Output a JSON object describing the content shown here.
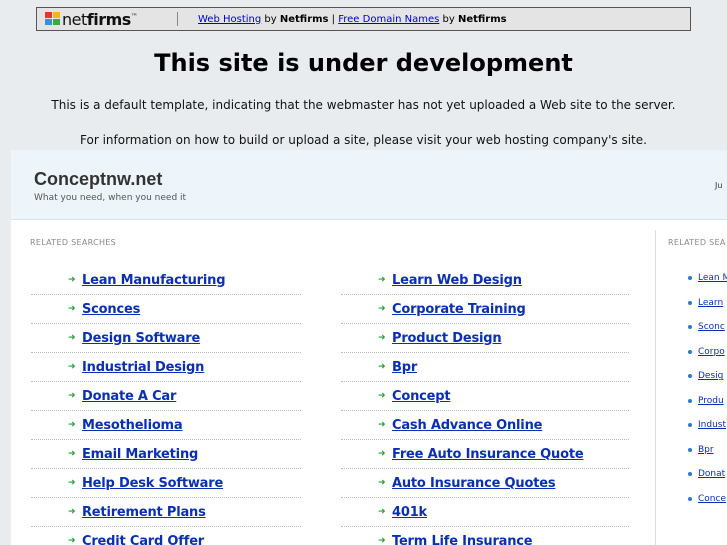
{
  "netfirms_bar": {
    "logo_text_1": "net",
    "logo_text_2": "firms",
    "logo_tm": "™",
    "link1": "Web Hosting",
    "by1": " by ",
    "brand1": "Netfirms",
    "pipe": " | ",
    "link2": "Free Domain Names",
    "by2": " by ",
    "brand2": "Netfirms"
  },
  "header": {
    "title": "This site is under development",
    "line1": "This is a default template, indicating that the webmaster has not yet uploaded a Web site to the server.",
    "line2": "For information on how to build or upload a site, please visit your web hosting company's site."
  },
  "parked": {
    "domain": "Conceptnw.net",
    "tagline": "What you need, when you need it",
    "right_text": "Ju",
    "related_label": "RELATED SEARCHES",
    "side_label": "RELATED SEA",
    "col1": [
      "Lean Manufacturing",
      "Sconces",
      "Design Software",
      "Industrial Design",
      "Donate A Car",
      "Mesothelioma",
      "Email Marketing",
      "Help Desk Software",
      "Retirement Plans",
      "Credit Card Offer"
    ],
    "col2": [
      "Learn Web Design",
      "Corporate Training",
      "Product Design",
      "Bpr",
      "Concept",
      "Cash Advance Online",
      "Free Auto Insurance Quote",
      "Auto Insurance Quotes",
      "401k",
      "Term Life Insurance"
    ],
    "side": [
      "Lean M",
      "Learn",
      "Sconc",
      "Corpo",
      "Desig",
      "Produ",
      "Indust",
      "Bpr",
      "Donat",
      "Conce"
    ]
  },
  "colors": {
    "link": "#0a2fb0",
    "arrow": "#2a9d3a",
    "header_bg": "#edf4fa",
    "page_bg": "#e9ecef"
  }
}
